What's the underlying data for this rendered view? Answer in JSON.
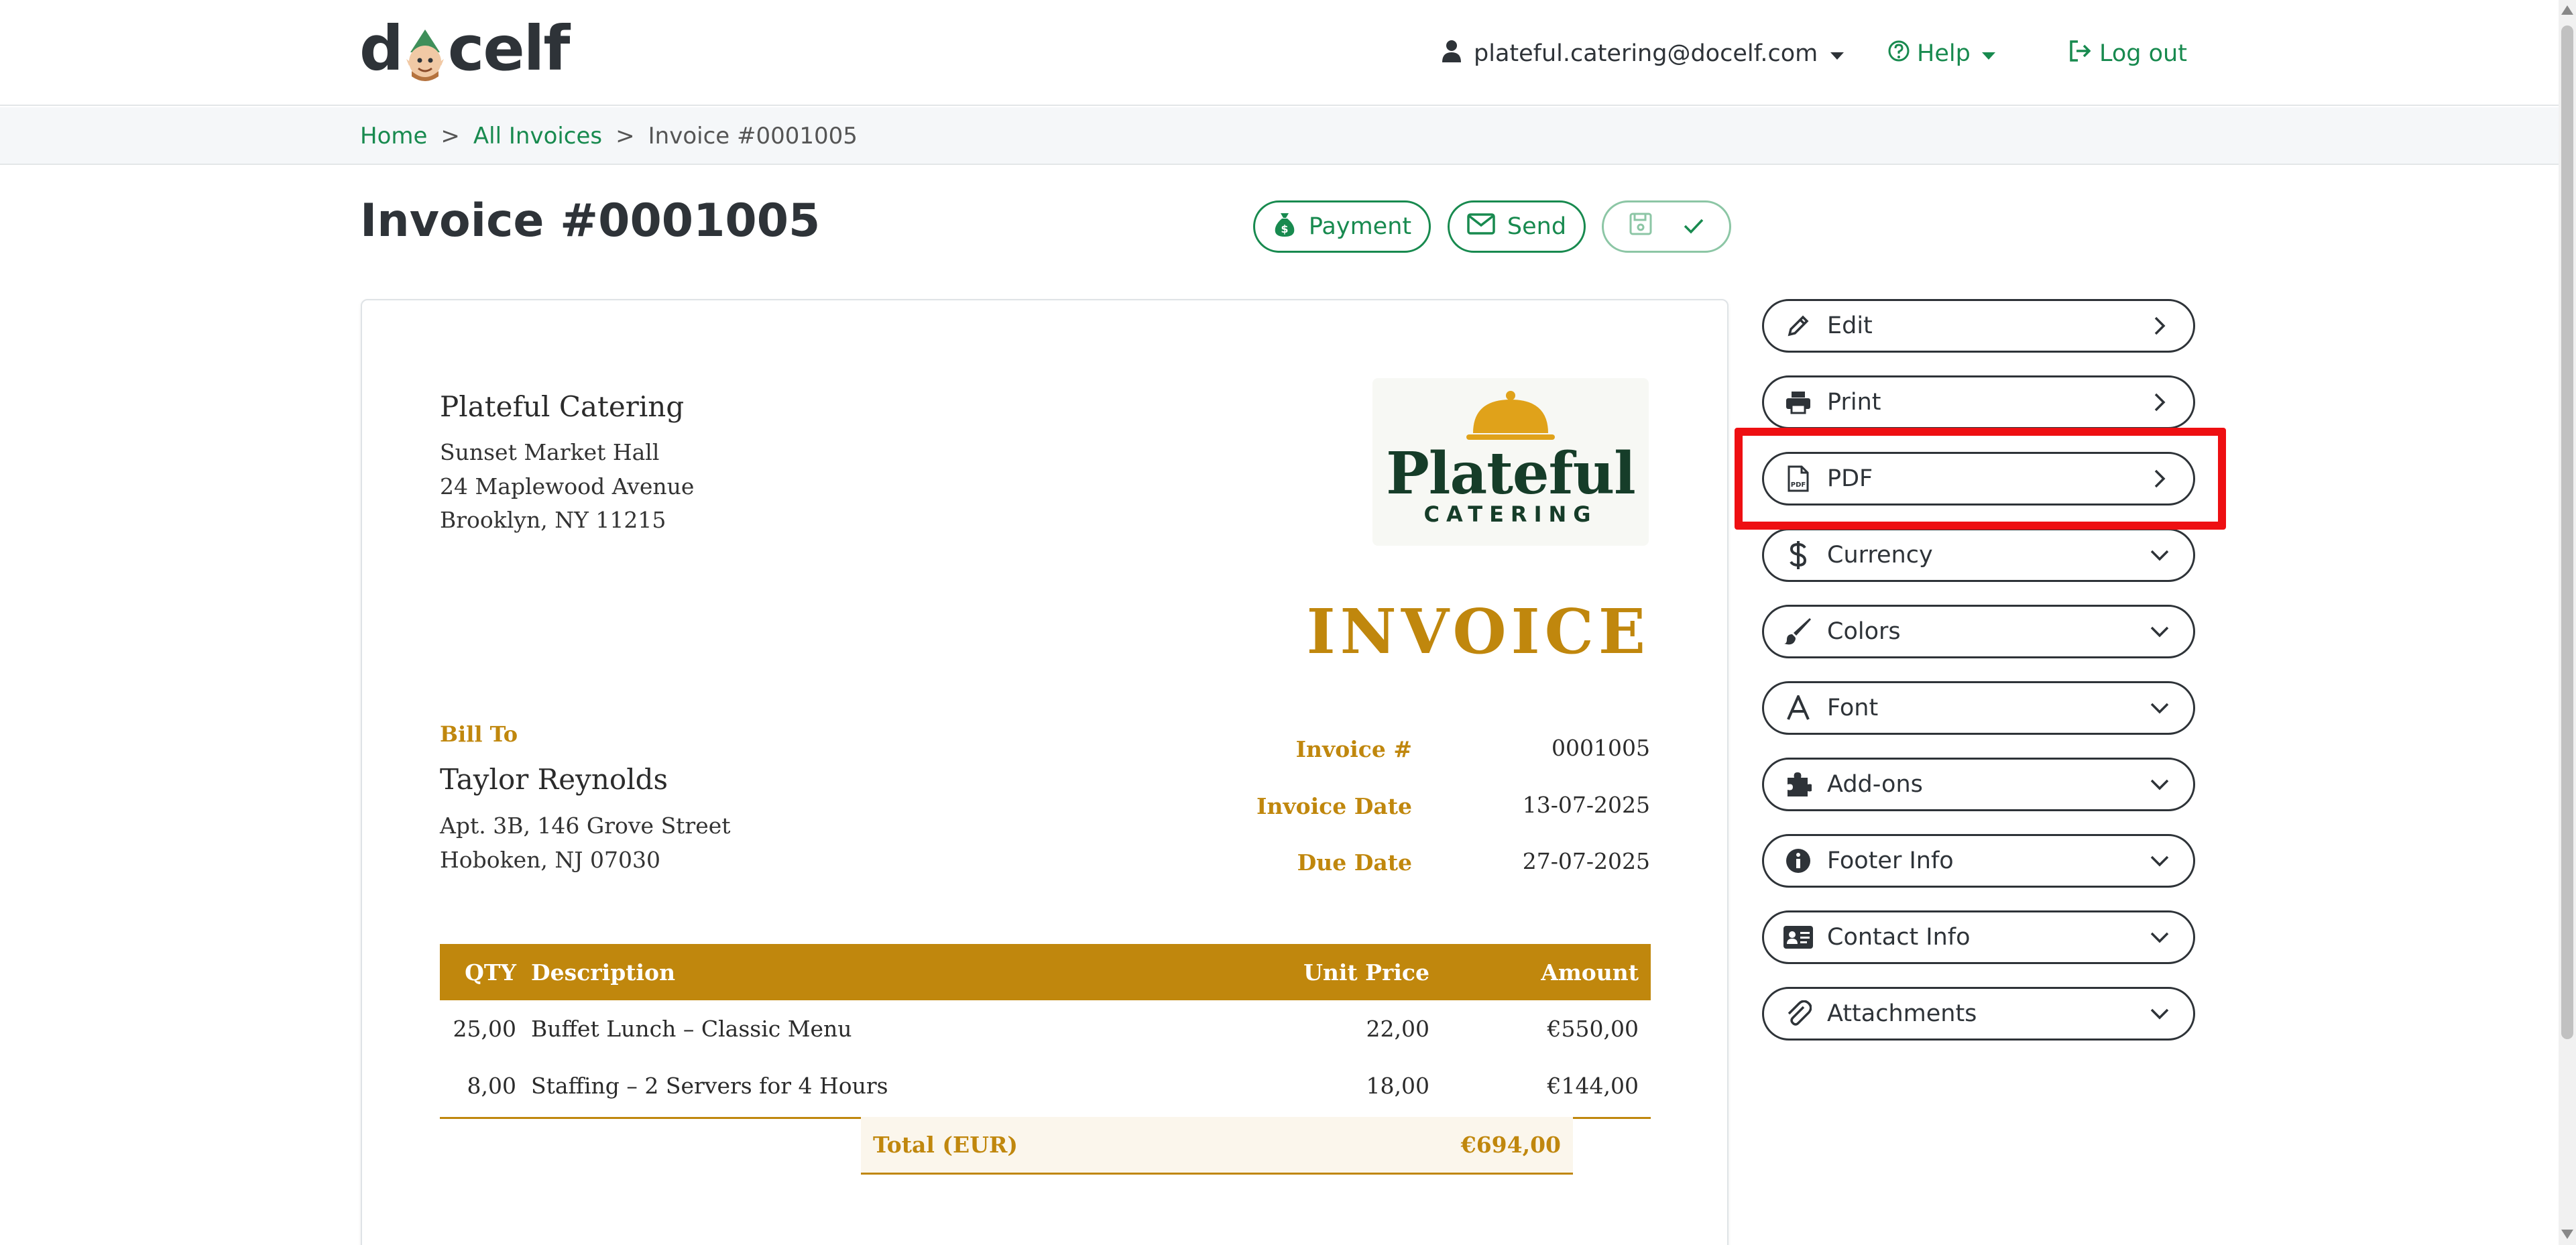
{
  "header": {
    "logo_prefix": "d",
    "logo_suffix": "celf",
    "user_email": "plateful.catering@docelf.com",
    "help_label": "Help",
    "logout_label": "Log out"
  },
  "breadcrumb": {
    "items": [
      "Home",
      "All Invoices",
      "Invoice #0001005"
    ],
    "separator": ">"
  },
  "page": {
    "title": "Invoice #0001005",
    "payment_label": "Payment",
    "send_label": "Send"
  },
  "invoice": {
    "company": {
      "name": "Plateful Catering",
      "lines": [
        "Sunset Market Hall",
        "24 Maplewood Avenue",
        "Brooklyn, NY 11215"
      ]
    },
    "logo": {
      "word": "Plateful",
      "sub": "CATERING"
    },
    "heading": "INVOICE",
    "bill_to_label": "Bill To",
    "client": {
      "name": "Taylor Reynolds",
      "lines": [
        "Apt. 3B, 146 Grove Street",
        "Hoboken, NJ 07030"
      ]
    },
    "meta": [
      {
        "label": "Invoice #",
        "value": "0001005"
      },
      {
        "label": "Invoice Date",
        "value": "13-07-2025"
      },
      {
        "label": "Due Date",
        "value": "27-07-2025"
      }
    ],
    "table": {
      "headers": {
        "qty": "QTY",
        "desc": "Description",
        "unit": "Unit Price",
        "amount": "Amount"
      },
      "rows": [
        {
          "qty": "25,00",
          "desc": "Buffet Lunch – Classic Menu",
          "unit": "22,00",
          "amount": "€550,00"
        },
        {
          "qty": "8,00",
          "desc": "Staffing – 2 Servers for 4 Hours",
          "unit": "18,00",
          "amount": "€144,00"
        }
      ],
      "total_label": "Total (EUR)",
      "total_value": "€694,00"
    }
  },
  "sidebar": {
    "items": [
      {
        "label": "Edit",
        "icon": "pencil-icon",
        "trail": "chevron-right"
      },
      {
        "label": "Print",
        "icon": "printer-icon",
        "trail": "chevron-right"
      },
      {
        "label": "PDF",
        "icon": "pdf-file-icon",
        "trail": "chevron-right"
      },
      {
        "label": "Currency",
        "icon": "dollar-icon",
        "trail": "chevron-down"
      },
      {
        "label": "Colors",
        "icon": "paintbrush-icon",
        "trail": "chevron-down"
      },
      {
        "label": "Font",
        "icon": "font-icon",
        "trail": "chevron-down"
      },
      {
        "label": "Add-ons",
        "icon": "puzzle-icon",
        "trail": "chevron-down"
      },
      {
        "label": "Footer Info",
        "icon": "info-icon",
        "trail": "chevron-down"
      },
      {
        "label": "Contact Info",
        "icon": "contact-card-icon",
        "trail": "chevron-down"
      },
      {
        "label": "Attachments",
        "icon": "paperclip-icon",
        "trail": "chevron-down"
      }
    ]
  },
  "colors": {
    "brand_green": "#188a4f",
    "invoice_gold": "#c0870d",
    "highlight_red": "#ee0f12",
    "dark_text": "#2e3338"
  }
}
